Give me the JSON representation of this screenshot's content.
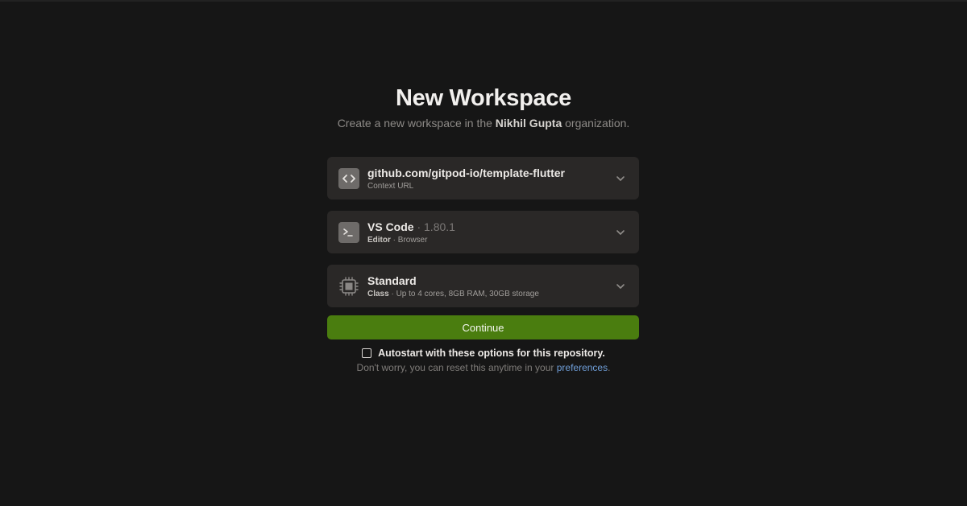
{
  "header": {
    "title": "New Workspace",
    "subtitle_prefix": "Create a new workspace in the ",
    "organization": "Nikhil Gupta",
    "subtitle_suffix": " organization."
  },
  "context": {
    "icon": "code-brackets-icon",
    "value": "github.com/gitpod-io/template-flutter",
    "label": "Context URL"
  },
  "editor": {
    "icon": "terminal-icon",
    "name": "VS Code",
    "version": "· 1.80.1",
    "label": "Editor",
    "detail": " · Browser"
  },
  "workspace_class": {
    "icon": "cpu-chip-icon",
    "name": "Standard",
    "label": "Class",
    "detail": " · Up to 4 cores, 8GB RAM, 30GB storage"
  },
  "actions": {
    "continue_label": "Continue"
  },
  "autostart": {
    "checked": false,
    "label": "Autostart with these options for this repository."
  },
  "note": {
    "text": "Don't worry, you can reset this anytime in your ",
    "link": "preferences",
    "suffix": "."
  },
  "colors": {
    "background": "#161616",
    "card": "#2a2827",
    "accent_green": "#4a7d0f",
    "link_blue": "#6f9ed8"
  }
}
